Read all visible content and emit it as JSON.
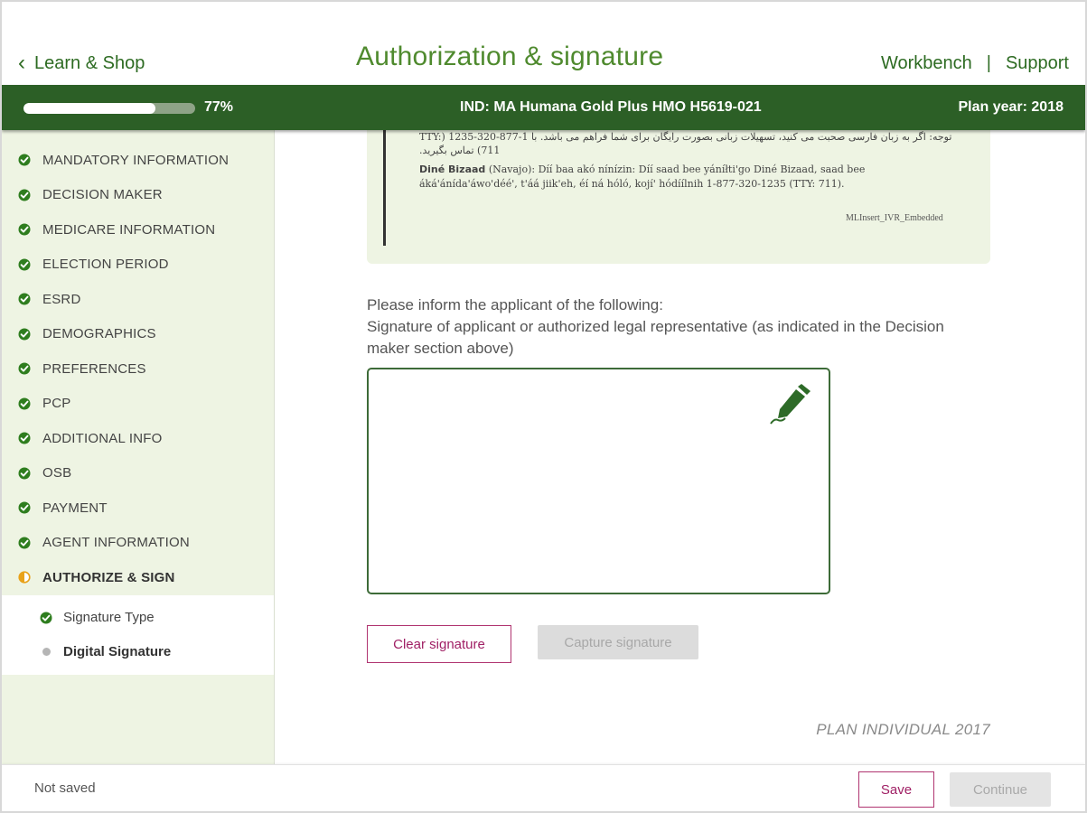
{
  "header": {
    "back_label": "Learn & Shop",
    "title": "Authorization & signature",
    "links": [
      "Workbench",
      "Support"
    ],
    "separator": "|"
  },
  "progress": {
    "value_fraction": 0.77,
    "percent_label": "77%",
    "plan_label": "IND: MA Humana Gold Plus HMO H5619-021",
    "plan_year_label": "Plan year: 2018"
  },
  "sidebar": {
    "items": [
      {
        "label": "MANDATORY INFORMATION",
        "status": "complete"
      },
      {
        "label": "DECISION MAKER",
        "status": "complete"
      },
      {
        "label": "MEDICARE INFORMATION",
        "status": "complete"
      },
      {
        "label": "ELECTION PERIOD",
        "status": "complete"
      },
      {
        "label": "ESRD",
        "status": "complete"
      },
      {
        "label": "DEMOGRAPHICS",
        "status": "complete"
      },
      {
        "label": "PREFERENCES",
        "status": "complete"
      },
      {
        "label": "PCP",
        "status": "complete"
      },
      {
        "label": "ADDITIONAL INFO",
        "status": "complete"
      },
      {
        "label": "OSB",
        "status": "complete"
      },
      {
        "label": "PAYMENT",
        "status": "complete"
      },
      {
        "label": "AGENT INFORMATION",
        "status": "complete"
      },
      {
        "label": "AUTHORIZE & SIGN",
        "status": "in-progress"
      }
    ],
    "subitems": [
      {
        "label": "Signature Type",
        "status": "complete"
      },
      {
        "label": "Digital Signature",
        "status": "current"
      }
    ]
  },
  "notice": {
    "farsi_text": "توجه: اگر به زبان فارسی صحبت می کنید، تسهیلات زبانی بصورت رایگان برای شما فراهم می باشد. با 1-877-320-1235 (TTY: 711) تماس بگیرید.",
    "navajo_lang": "Diné Bizaad",
    "navajo_tag": "(Navajo):",
    "navajo_text": "Díí baa akó nínízin: Díí saad bee yáníłti'go Diné Bizaad, saad bee áká'ánída'áwo'déé', t'áá jiik'eh, éí ná hóló, kojí' hódíílnih 1-877-320-1235 (TTY: 711).",
    "ref_code": "MLInsert_IVR_Embedded"
  },
  "main": {
    "instruction_line1": "Please inform the applicant of the following:",
    "instruction_line2": "Signature of applicant or authorized legal representative (as indicated in the Decision maker section above)",
    "clear_label": "Clear signature",
    "capture_label": "Capture signature",
    "plan_footer": "PLAN INDIVIDUAL 2017"
  },
  "footer": {
    "status": "Not saved",
    "save_label": "Save",
    "continue_label": "Continue"
  },
  "colors": {
    "brand_green": "#2c5f26",
    "title_green": "#4f8a2e",
    "check_green": "#2e7d1e",
    "warn_orange": "#e8a21a",
    "accent_magenta": "#a02065",
    "sidebar_bg": "#eef4e3"
  },
  "icons": {
    "back": "chevron-left-icon",
    "complete": "check-circle-icon",
    "in_progress": "half-circle-icon",
    "pending": "dot-icon",
    "sign": "pen-icon"
  }
}
